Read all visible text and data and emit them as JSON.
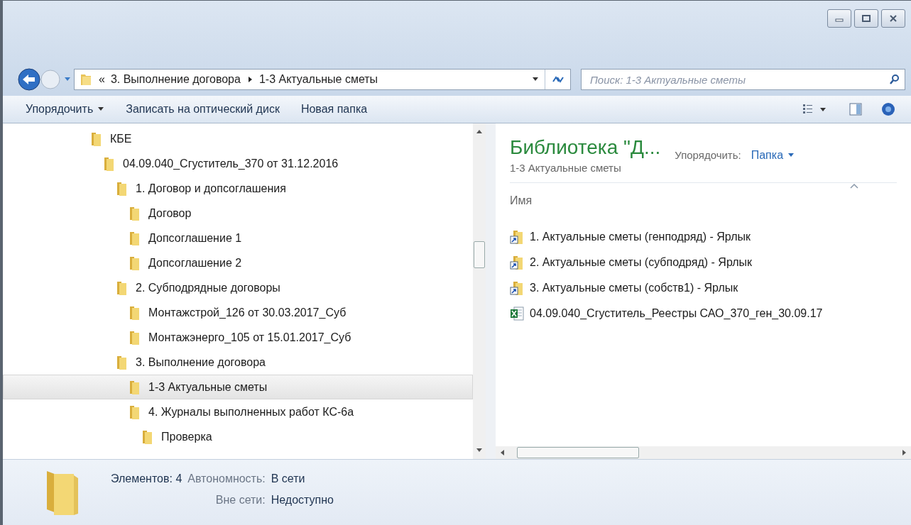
{
  "address_bar": {
    "overflow_mark": "«",
    "crumbs": [
      "3. Выполнение договора",
      "1-3 Актуальные сметы"
    ]
  },
  "search": {
    "placeholder": "Поиск: 1-3 Актуальные сметы"
  },
  "toolbar": {
    "organize": "Упорядочить",
    "burn": "Записать на оптический диск",
    "new_folder": "Новая папка"
  },
  "tree": [
    {
      "label": "КБЕ",
      "selected": false,
      "children": [
        {
          "label": "04.09.040_Сгуститель_370 от 31.12.2016",
          "selected": false,
          "children": [
            {
              "label": "1. Договор и допсоглашения",
              "selected": false,
              "children": [
                {
                  "label": "Договор",
                  "selected": false
                },
                {
                  "label": "Допсоглашение 1",
                  "selected": false
                },
                {
                  "label": "Допсоглашение 2",
                  "selected": false
                }
              ]
            },
            {
              "label": "2. Субподрядные договоры",
              "selected": false,
              "children": [
                {
                  "label": "Монтажстрой_126 от 30.03.2017_Суб",
                  "selected": false
                },
                {
                  "label": "Монтажэнерго_105 от 15.01.2017_Суб",
                  "selected": false
                }
              ]
            },
            {
              "label": "3. Выполнение договора",
              "selected": false,
              "children": [
                {
                  "label": "1-3 Актуальные сметы",
                  "selected": true
                },
                {
                  "label": "4. Журналы выполненных работ КС-6а",
                  "selected": false,
                  "children": [
                    {
                      "label": "Проверка",
                      "selected": false
                    }
                  ]
                }
              ]
            }
          ]
        }
      ]
    }
  ],
  "library": {
    "title": "Библиотека \"Д...",
    "subtitle": "1-3 Актуальные сметы",
    "arrange_label": "Упорядочить:",
    "arrange_value": "Папка"
  },
  "columns": [
    "Имя"
  ],
  "files": [
    {
      "name": "1. Актуальные сметы (генподряд) - Ярлык",
      "kind": "shortcut"
    },
    {
      "name": "2. Актуальные сметы (субподряд) - Ярлык",
      "kind": "shortcut"
    },
    {
      "name": "3. Актуальные сметы (собств1) - Ярлык",
      "kind": "shortcut"
    },
    {
      "name": "04.09.040_Сгуститель_Реестры САО_370_ген_30.09.17",
      "kind": "spreadsheet"
    }
  ],
  "details": {
    "count_label": "Элементов: 4",
    "offline_label": "Автономность:",
    "offline_value": "В сети",
    "avail_label": "Вне сети:",
    "avail_value": "Недоступно"
  }
}
